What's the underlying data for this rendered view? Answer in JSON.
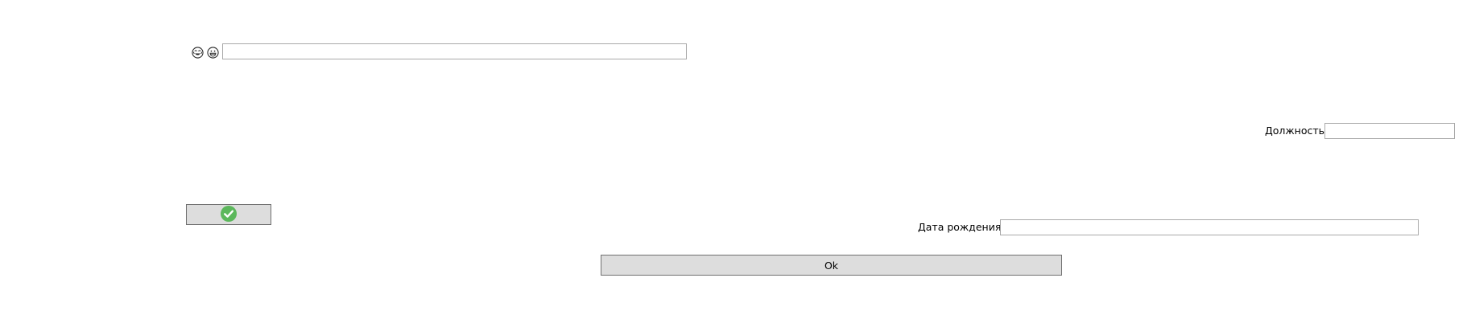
{
  "form": {
    "emoji_icons": [
      "smiling-tears-face-icon",
      "grinning-face-icon"
    ],
    "name_field": {
      "value": "",
      "placeholder": ""
    },
    "position": {
      "label": "Должность",
      "value": ""
    },
    "check_button": {
      "icon": "check-circle-icon",
      "icon_color": "#5cb85c"
    },
    "birth_date": {
      "label": "Дата рождения",
      "value": ""
    },
    "ok_button": {
      "label": "Ok"
    }
  },
  "colors": {
    "background": "#ffffff",
    "input_border": "#a9a9a9",
    "button_bg": "#dddddd",
    "button_border": "#707070",
    "check_green": "#5cb85c"
  }
}
